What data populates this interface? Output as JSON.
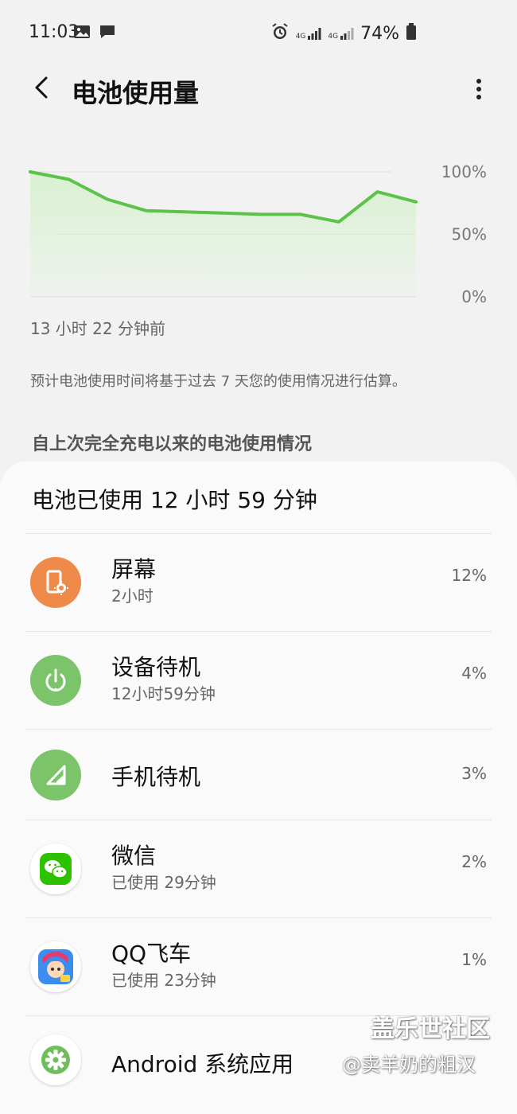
{
  "status_bar": {
    "time": "11:03",
    "network": "4G",
    "battery_percent": "74%",
    "left_icons": [
      "image-icon",
      "message-icon"
    ],
    "right_icons": [
      "alarm-icon",
      "signal-icon",
      "signal-icon",
      "battery-icon"
    ]
  },
  "app_bar": {
    "title": "电池使用量",
    "back_icon": "back-arrow-icon",
    "more_icon": "more-vertical-icon"
  },
  "chart_data": {
    "type": "area",
    "x": [
      0,
      10,
      20,
      30,
      40,
      50,
      60,
      70,
      80,
      90,
      100
    ],
    "series": [
      {
        "values": [
          100,
          94,
          78,
          69,
          68,
          67,
          66,
          66,
          60,
          84,
          76
        ]
      }
    ],
    "ylim": [
      0,
      100
    ],
    "ytick_labels": [
      "100%",
      "50%",
      "0%"
    ],
    "line_color": "#5cc24a",
    "fill_color": "#d7f1cf",
    "grid": true
  },
  "chart_text": {
    "start_label": "13 小时 22 分钟前",
    "note": "预计电池使用时间将基于过去 7 天您的使用情况进行估算。",
    "section_title": "自上次完全充电以来的电池使用情况"
  },
  "usage": {
    "summary": "电池已使用 12 小时 59 分钟",
    "items": [
      {
        "name": "屏幕",
        "sub": "2小时",
        "percent": "12%",
        "icon": "screen-brightness-icon",
        "icon_color": "#f08a4b"
      },
      {
        "name": "设备待机",
        "sub": "12小时59分钟",
        "percent": "4%",
        "icon": "power-icon",
        "icon_color": "#7cc46a"
      },
      {
        "name": "手机待机",
        "sub": "",
        "percent": "3%",
        "icon": "signal-strength-icon",
        "icon_color": "#7cc46a"
      },
      {
        "name": "微信",
        "sub": "已使用 29分钟",
        "percent": "2%",
        "icon": "wechat-icon",
        "icon_color": "#2dc100"
      },
      {
        "name": "QQ飞车",
        "sub": "已使用 23分钟",
        "percent": "1%",
        "icon": "game-avatar-icon",
        "icon_color": "#3b8df0"
      },
      {
        "name": "Android 系统应用",
        "sub": "",
        "percent": "",
        "icon": "gear-icon",
        "icon_color": "#6fbe5b"
      }
    ]
  },
  "watermark": {
    "line1": "盖乐世社区",
    "line2": "@卖羊奶的粗汉"
  }
}
